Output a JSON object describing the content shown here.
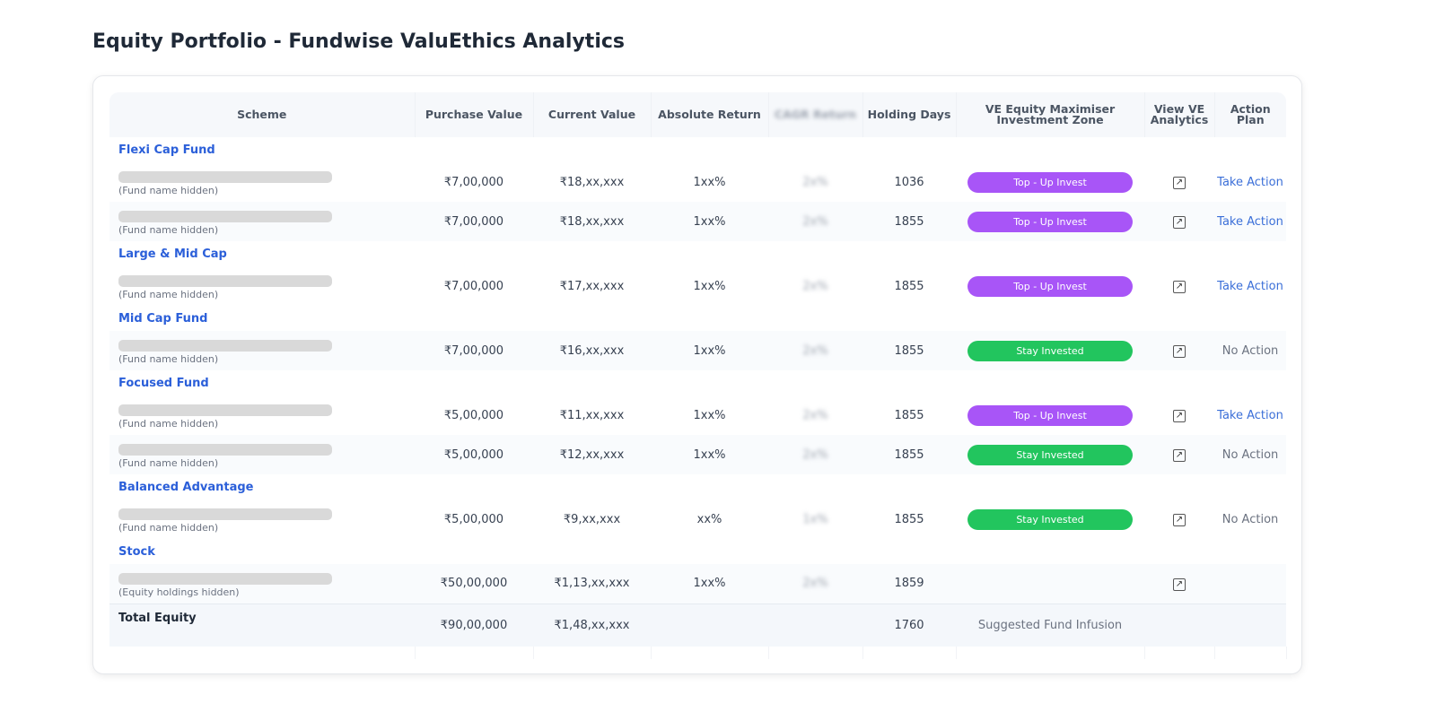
{
  "page": {
    "title": "Equity Portfolio - Fundwise ValuEthics Analytics"
  },
  "colors": {
    "top_up": "#a855f7",
    "stay": "#22c55e",
    "link": "#2b5fd9"
  },
  "table": {
    "headers": [
      "Scheme",
      "Purchase Value",
      "Current Value",
      "Absolute Return",
      "CAGR Return",
      "Holding Days",
      "VE Equity Maximiser Investment Zone",
      "View VE Analytics",
      "Action Plan"
    ],
    "groups": [
      {
        "category": "Flexi Cap Fund",
        "rows": [
          {
            "note": "(Fund name hidden)",
            "purchase": "₹7,00,000",
            "current": "₹18,xx,xxx",
            "abs": "1xx%",
            "cagr": "2x%",
            "days": "1036",
            "zone": "Top - Up Invest",
            "zone_type": "top_up",
            "action": "Take Action"
          },
          {
            "note": "(Fund name hidden)",
            "purchase": "₹7,00,000",
            "current": "₹18,xx,xxx",
            "abs": "1xx%",
            "cagr": "2x%",
            "days": "1855",
            "zone": "Top - Up Invest",
            "zone_type": "top_up",
            "action": "Take Action"
          }
        ]
      },
      {
        "category": "Large & Mid Cap",
        "rows": [
          {
            "note": "(Fund name hidden)",
            "purchase": "₹7,00,000",
            "current": "₹17,xx,xxx",
            "abs": "1xx%",
            "cagr": "2x%",
            "days": "1855",
            "zone": "Top - Up Invest",
            "zone_type": "top_up",
            "action": "Take Action"
          }
        ]
      },
      {
        "category": "Mid Cap Fund",
        "rows": [
          {
            "note": "(Fund name hidden)",
            "purchase": "₹7,00,000",
            "current": "₹16,xx,xxx",
            "abs": "1xx%",
            "cagr": "2x%",
            "days": "1855",
            "zone": "Stay Invested",
            "zone_type": "stay",
            "action": "No Action"
          }
        ]
      },
      {
        "category": "Focused Fund",
        "rows": [
          {
            "note": "(Fund name hidden)",
            "purchase": "₹5,00,000",
            "current": "₹11,xx,xxx",
            "abs": "1xx%",
            "cagr": "2x%",
            "days": "1855",
            "zone": "Top - Up Invest",
            "zone_type": "top_up",
            "action": "Take Action"
          },
          {
            "note": "(Fund name hidden)",
            "purchase": "₹5,00,000",
            "current": "₹12,xx,xxx",
            "abs": "1xx%",
            "cagr": "2x%",
            "days": "1855",
            "zone": "Stay Invested",
            "zone_type": "stay",
            "action": "No Action"
          }
        ]
      },
      {
        "category": "Balanced Advantage",
        "rows": [
          {
            "note": "(Fund name hidden)",
            "purchase": "₹5,00,000",
            "current": "₹9,xx,xxx",
            "abs": "xx%",
            "cagr": "1x%",
            "days": "1855",
            "zone": "Stay Invested",
            "zone_type": "stay",
            "action": "No Action"
          }
        ]
      },
      {
        "category": "Stock",
        "rows": [
          {
            "note": "(Equity holdings hidden)",
            "purchase": "₹50,00,000",
            "current": "₹1,13,xx,xxx",
            "abs": "1xx%",
            "cagr": "2x%",
            "days": "1859",
            "zone": "",
            "zone_type": "",
            "action": ""
          }
        ]
      }
    ],
    "total": {
      "label": "Total Equity",
      "purchase": "₹90,00,000",
      "current": "₹1,48,xx,xxx",
      "days": "1760",
      "zone": "Suggested Fund Infusion"
    }
  }
}
